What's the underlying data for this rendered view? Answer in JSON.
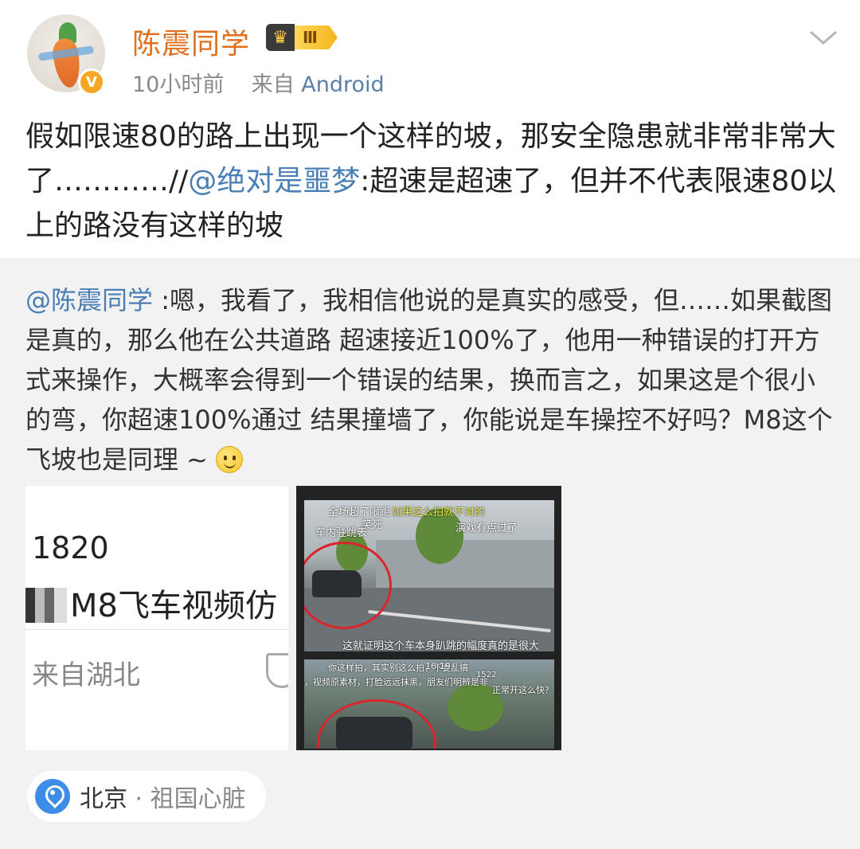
{
  "author": {
    "name": "陈震同学",
    "level_badge": "Ⅲ",
    "time": "10小时前",
    "source_prefix": "来自",
    "source": "Android"
  },
  "post": {
    "text_part1": "假如限速80的路上出现一个这样的坡，那安全隐患就非常非常大了…………//",
    "mention": "@绝对是噩梦",
    "text_part2": ":超速是超速了，但并不代表限速80以上的路没有这样的坡"
  },
  "repost": {
    "mention": "@陈震同学",
    "text": " :嗯，我看了，我相信他说的是真实的感受，但……如果截图是真的，那么他在公共道路 超速接近100%了，他用一种错误的打开方式来操作，大概率会得到一个错误的结果，换而言之，如果这是个很小的弯，你超速100%通过 结果撞墙了，你能说是车操控不好吗？M8这个飞坡也是同理 ~ "
  },
  "image1": {
    "number": "1820",
    "title": "M8飞车视频仿",
    "location": "来自湖北"
  },
  "image2": {
    "top_captions": [
      "全场超了限距",
      "如果这么拍就不对的",
      "笑死"
    ],
    "left_caption": "车内驻跳表",
    "right_caption": "演戏有点过了",
    "subtitle": "这就证明这个车本身趴跳的幅度真的是很大",
    "frame2_header": "你这样拍，其实别这么拍，不要乱搞",
    "frame2_time": "16:19",
    "frame2_caption": "，视频原素材，打脸远远抹黑，朋友们明辨是非",
    "frame2_count": "1522",
    "frame2_overlay": "正常开这么快？"
  },
  "location": {
    "city": "北京",
    "separator": "·",
    "desc": "祖国心脏"
  },
  "colors": {
    "username": "#e06f1e",
    "mention": "#4a7fb5",
    "repost_bg": "#f2f2f2",
    "pin": "#3d8ce8"
  },
  "icons": [
    "verified-icon",
    "crown-icon",
    "chevron-down-icon",
    "smiley-icon",
    "location-pin-icon",
    "shield-icon"
  ]
}
